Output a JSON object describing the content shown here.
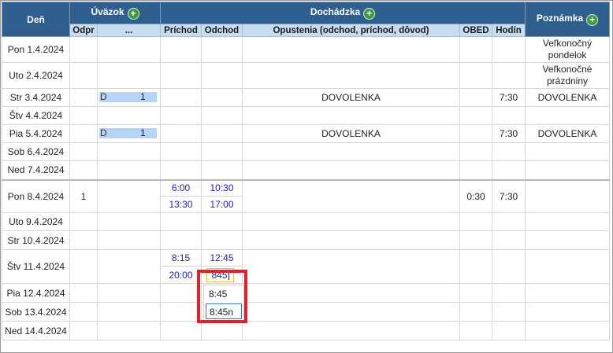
{
  "header": {
    "day": "Deň",
    "uvazok": "Úväzok",
    "dochadzka": "Dochádzka",
    "poznamka": "Poznámka",
    "odpr": "Odpr",
    "dots": "...",
    "prichod": "Príchod",
    "odchod": "Odchod",
    "opustenia": "Opustenia (odchod, príchod, dôvod)",
    "obed": "OBED",
    "hodin": "Hodín",
    "plus_icon": "plus-circle-icon"
  },
  "rows": [
    {
      "day": "Pon 1.4.2024",
      "note": "Veľkonočný pondelok"
    },
    {
      "day": "Uto 2.4.2024",
      "note": "Veľkonočné prázdniny"
    },
    {
      "day": "Str 3.4.2024",
      "uv_code": "D",
      "uv_num": "1",
      "reason": "DOVOLENKA",
      "hours": "7:30",
      "note": "DOVOLENKA"
    },
    {
      "day": "Štv 4.4.2024"
    },
    {
      "day": "Pia 5.4.2024",
      "uv_code": "D",
      "uv_num": "1",
      "reason": "DOVOLENKA",
      "hours": "7:30",
      "note": "DOVOLENKA"
    },
    {
      "day": "Sob 6.4.2024"
    },
    {
      "day": "Ned 7.4.2024"
    },
    {
      "day": "Pon 8.4.2024",
      "odpr": "1",
      "in1": "6:00",
      "out1": "10:30",
      "in2": "13:30",
      "out2": "17:00",
      "obed": "0:30",
      "hours": "7:30"
    },
    {
      "day": "Uto 9.4.2024"
    },
    {
      "day": "Str 10.4.2024"
    },
    {
      "day": "Štv 11.4.2024",
      "in1": "8:15",
      "out1": "12:45",
      "in2": "20:00",
      "out2_input": "845"
    },
    {
      "day": "Pia 12.4.2024"
    },
    {
      "day": "Sob 13.4.2024"
    },
    {
      "day": "Ned 14.4.2024"
    }
  ],
  "autocomplete": {
    "options": [
      "8:45",
      "8:45n"
    ],
    "selected_index": 1
  },
  "colors": {
    "header_bg": "#2f5f8f",
    "subheader_bg": "#c8dcef",
    "uvazok_bar": "#b5d4f7",
    "time_text": "#2222aa",
    "highlight_red": "#e0202a",
    "plus_green": "#3e9a3e"
  }
}
